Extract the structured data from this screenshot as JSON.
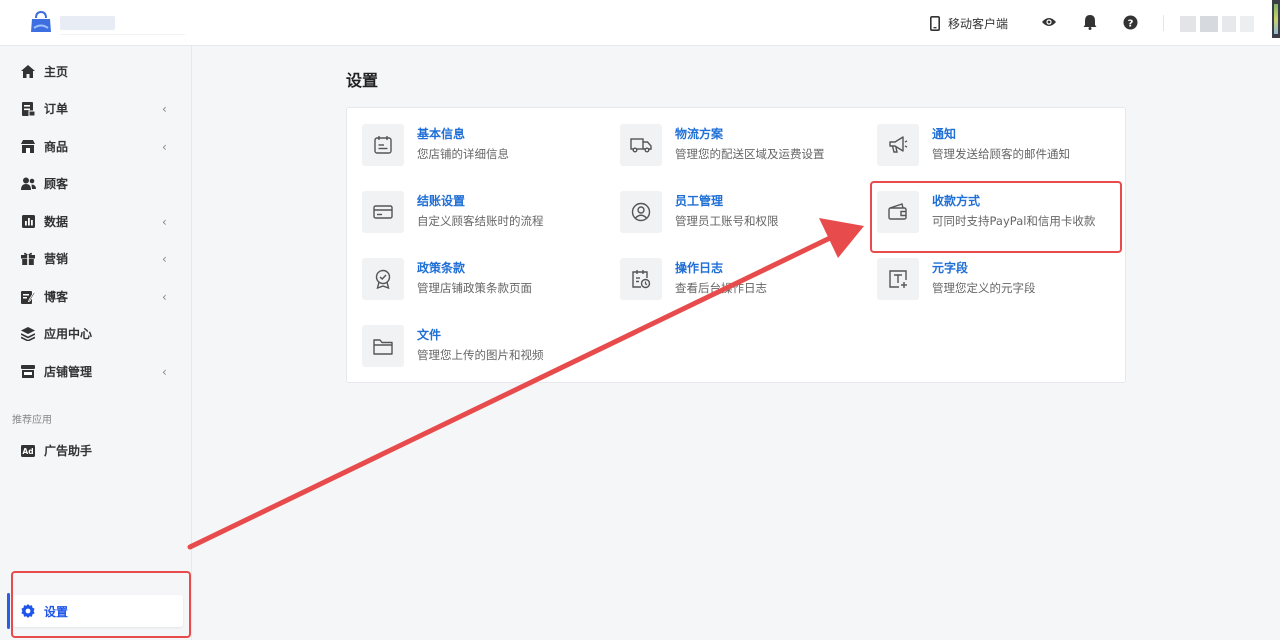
{
  "header": {
    "mobile_label": "移动客户端",
    "icons": [
      "preview-eye-icon",
      "notification-bell-icon",
      "help-question-icon"
    ]
  },
  "sidebar": {
    "items": [
      {
        "label": "主页",
        "icon": "home-icon",
        "has_submenu": false
      },
      {
        "label": "订单",
        "icon": "orders-icon",
        "has_submenu": true
      },
      {
        "label": "商品",
        "icon": "products-icon",
        "has_submenu": true
      },
      {
        "label": "顾客",
        "icon": "customers-icon",
        "has_submenu": false
      },
      {
        "label": "数据",
        "icon": "analytics-icon",
        "has_submenu": true
      },
      {
        "label": "营销",
        "icon": "marketing-icon",
        "has_submenu": true
      },
      {
        "label": "博客",
        "icon": "blog-icon",
        "has_submenu": true
      },
      {
        "label": "应用中心",
        "icon": "apps-layers-icon",
        "has_submenu": false
      },
      {
        "label": "店铺管理",
        "icon": "store-icon",
        "has_submenu": true
      }
    ],
    "chevron": "‹",
    "section_title": "推荐应用",
    "recommended": [
      {
        "label": "广告助手",
        "icon": "ad-icon"
      }
    ],
    "settings_label": "设置"
  },
  "main": {
    "title": "设置",
    "tiles": [
      {
        "title": "基本信息",
        "desc": "您店铺的详细信息",
        "icon": "calendar-info-icon"
      },
      {
        "title": "物流方案",
        "desc": "管理您的配送区域及运费设置",
        "icon": "truck-icon"
      },
      {
        "title": "通知",
        "desc": "管理发送给顾客的邮件通知",
        "icon": "megaphone-icon"
      },
      {
        "title": "结账设置",
        "desc": "自定义顾客结账时的流程",
        "icon": "credit-card-icon"
      },
      {
        "title": "员工管理",
        "desc": "管理员工账号和权限",
        "icon": "user-circle-icon"
      },
      {
        "title": "收款方式",
        "desc": "可同时支持PayPal和信用卡收款",
        "icon": "wallet-icon"
      },
      {
        "title": "政策条款",
        "desc": "管理店铺政策条款页面",
        "icon": "badge-icon"
      },
      {
        "title": "操作日志",
        "desc": "查看后台操作日志",
        "icon": "log-calendar-icon"
      },
      {
        "title": "元字段",
        "desc": "管理您定义的元字段",
        "icon": "text-plus-icon"
      },
      {
        "title": "文件",
        "desc": "管理您上传的图片和视频",
        "icon": "folder-icon"
      }
    ]
  },
  "colors": {
    "accent": "#1f55e8",
    "link": "#1f6fd6",
    "annotation": "#e84b4b"
  }
}
